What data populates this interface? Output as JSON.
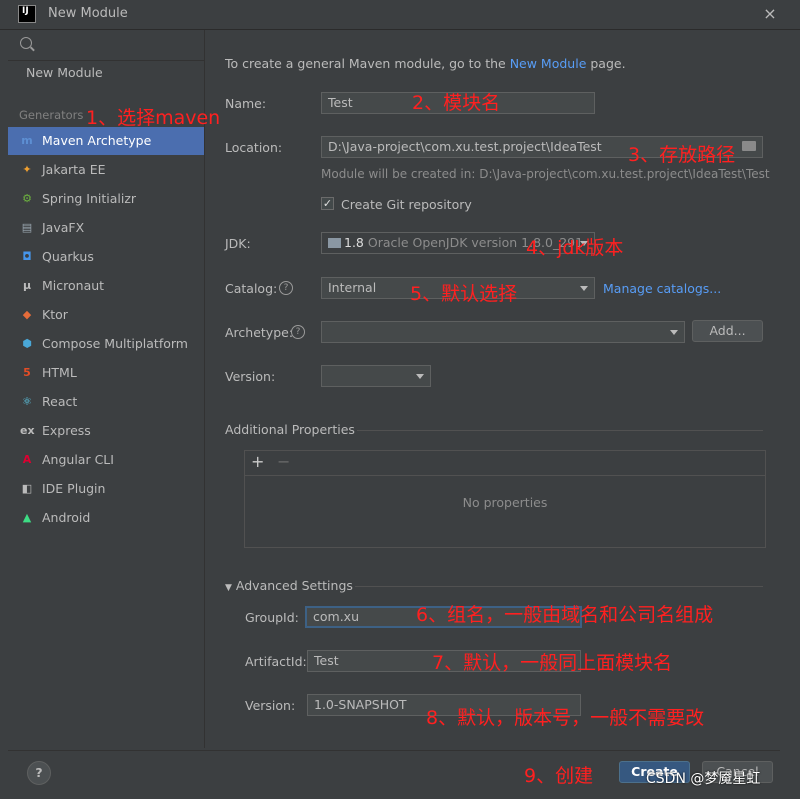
{
  "window": {
    "title": "New Module",
    "app_icon": "IJ",
    "close_icon": "×"
  },
  "sidebar": {
    "top_item": "New Module",
    "generators_label": "Generators",
    "items": [
      {
        "label": "Maven Archetype",
        "icon": "maven-icon",
        "glyph": "m",
        "color": "#5d8fd3"
      },
      {
        "label": "Jakarta EE",
        "icon": "jakarta-icon",
        "glyph": "✦",
        "color": "#f0a030"
      },
      {
        "label": "Spring Initializr",
        "icon": "spring-icon",
        "glyph": "⚙",
        "color": "#6db33f"
      },
      {
        "label": "JavaFX",
        "icon": "javafx-icon",
        "glyph": "▤",
        "color": "#9aa7b0"
      },
      {
        "label": "Quarkus",
        "icon": "quarkus-icon",
        "glyph": "◘",
        "color": "#4695eb"
      },
      {
        "label": "Micronaut",
        "icon": "micronaut-icon",
        "glyph": "μ",
        "color": "#bbbbbb"
      },
      {
        "label": "Ktor",
        "icon": "ktor-icon",
        "glyph": "◆",
        "color": "#e56c3a"
      },
      {
        "label": "Compose Multiplatform",
        "icon": "compose-icon",
        "glyph": "⬢",
        "color": "#4aa8d8"
      },
      {
        "label": "HTML",
        "icon": "html-icon",
        "glyph": "5",
        "color": "#e44d26"
      },
      {
        "label": "React",
        "icon": "react-icon",
        "glyph": "⚛",
        "color": "#61dafb"
      },
      {
        "label": "Express",
        "icon": "express-icon",
        "glyph": "ex",
        "color": "#bbbbbb"
      },
      {
        "label": "Angular CLI",
        "icon": "angular-icon",
        "glyph": "A",
        "color": "#dd0031"
      },
      {
        "label": "IDE Plugin",
        "icon": "plugin-icon",
        "glyph": "◧",
        "color": "#bbbbbb"
      },
      {
        "label": "Android",
        "icon": "android-icon",
        "glyph": "▲",
        "color": "#3ddc84"
      }
    ]
  },
  "main": {
    "intro_prefix": "To create a general Maven module, go to the ",
    "intro_link": "New Module",
    "intro_suffix": " page.",
    "name_label": "Name:",
    "name_value": "Test",
    "location_label": "Location:",
    "location_value": "D:\\Java-project\\com.xu.test.project\\IdeaTest",
    "location_hint": "Module will be created in: D:\\Java-project\\com.xu.test.project\\IdeaTest\\Test",
    "git_label": "Create Git repository",
    "git_checked": "✓",
    "jdk_label": "JDK:",
    "jdk_version": "1.8",
    "jdk_detail": "Oracle OpenJDK version 1.8.0_291",
    "catalog_label": "Catalog:",
    "catalog_value": "Internal",
    "manage_catalogs": "Manage catalogs...",
    "archetype_label": "Archetype:",
    "add_button": "Add...",
    "version_label": "Version:",
    "additional_properties": "Additional Properties",
    "add_prop": "+",
    "remove_prop": "−",
    "no_properties": "No properties",
    "advanced_settings": "Advanced Settings",
    "groupid_label": "GroupId:",
    "groupid_value": "com.xu",
    "artifactid_label": "ArtifactId:",
    "artifactid_value": "Test",
    "adv_version_label": "Version:",
    "adv_version_value": "1.0-SNAPSHOT"
  },
  "footer": {
    "help": "?",
    "create": "Create",
    "cancel": "Cancel"
  },
  "annotations": {
    "a1": "1、选择maven",
    "a2": "2、模块名",
    "a3": "3、存放路径",
    "a4": "4、jdk版本",
    "a5": "5、默认选择",
    "a6": "6、组名，一般由域名和公司名组成",
    "a7": "7、默认，一般同上面模块名",
    "a8": "8、默认，版本号，一般不需要改",
    "a9": "9、创建"
  },
  "watermark": "CSDN @梦魇星虹"
}
